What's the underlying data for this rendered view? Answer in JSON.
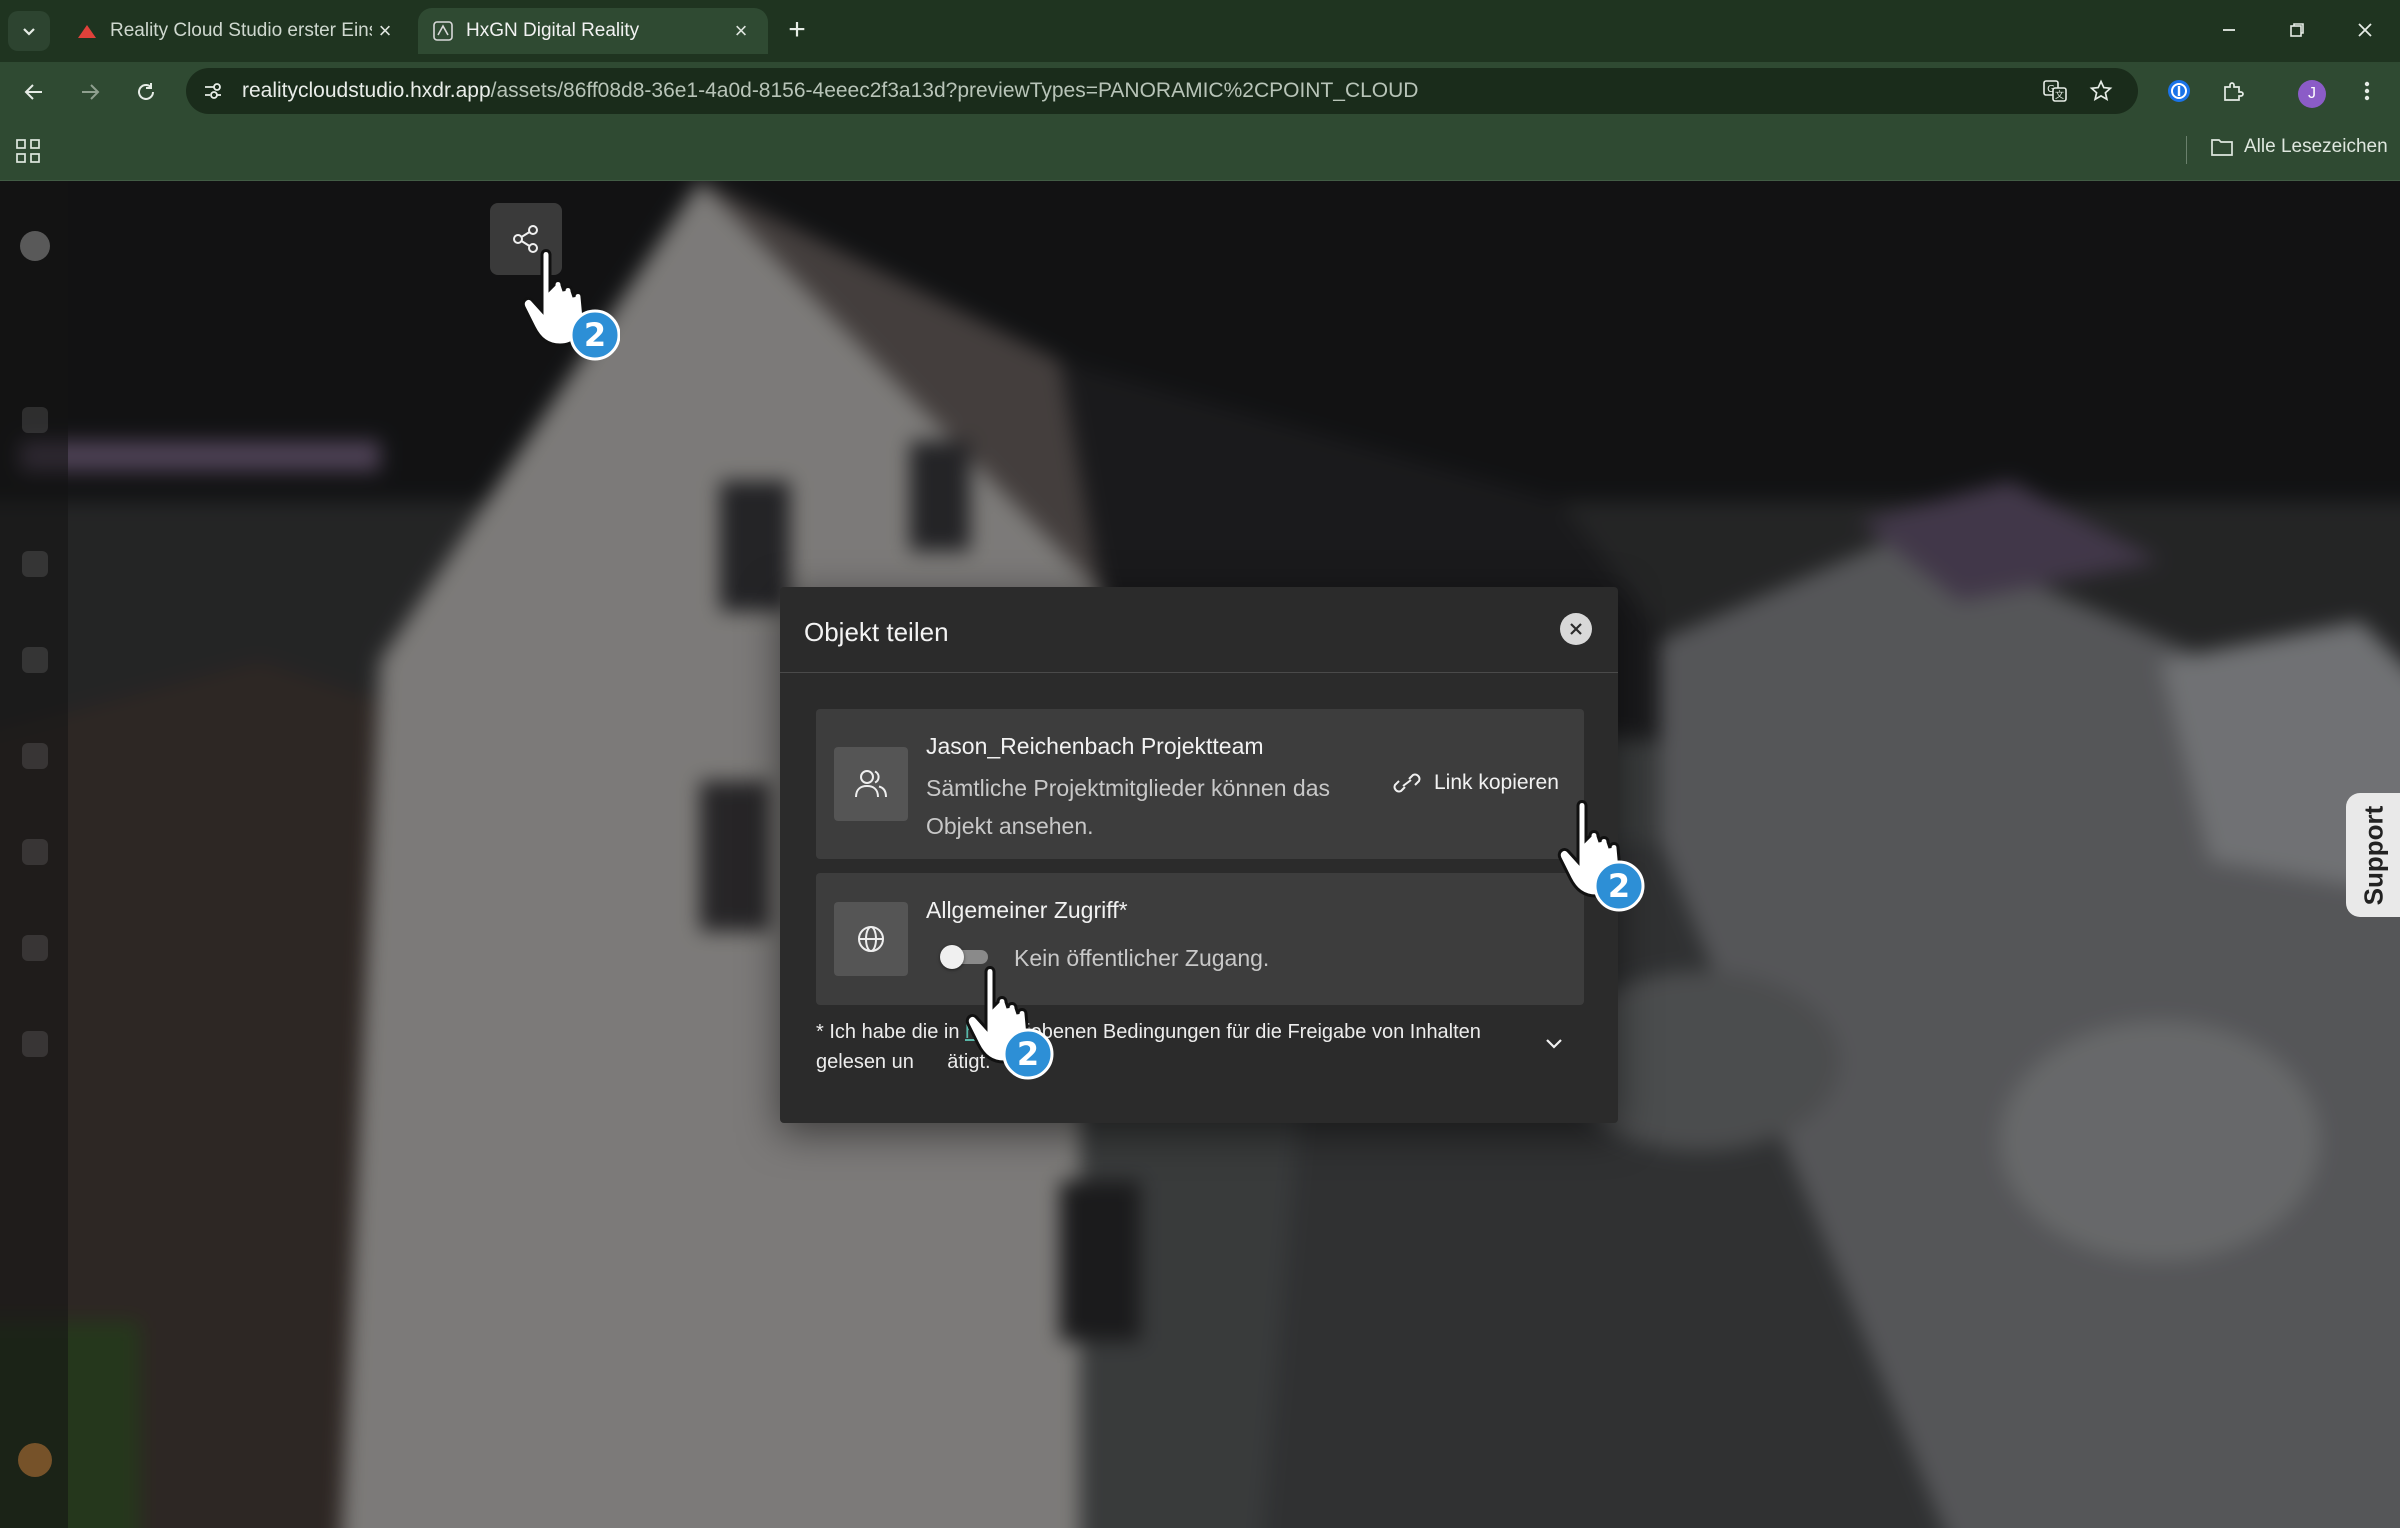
{
  "browser": {
    "tabs": [
      {
        "title": "Reality Cloud Studio erster Einst",
        "active": false,
        "icon": "red-triangle-icon"
      },
      {
        "title": "HxGN Digital Reality",
        "active": true,
        "icon": "hxgn-logo-icon"
      }
    ],
    "url_host": "realitycloudstudio.hxdr.app",
    "url_path": "/assets/86ff08d8-36e1-4a0d-8156-4eeec2f3a13d?previewTypes=PANORAMIC%2CPOINT_CLOUD",
    "profile_initial": "J",
    "bookmarks_label": "Alle Lesezeichen"
  },
  "modal": {
    "title": "Objekt teilen",
    "team_card": {
      "title": "Jason_Reichenbach Projektteam",
      "description": "Sämtliche Projektmitglieder können das Objekt ansehen.",
      "copy_link_label": "Link kopieren"
    },
    "access_card": {
      "title": "Allgemeiner Zugriff*",
      "toggle_label": "Kein öffentlicher Zugang.",
      "toggle_on": false
    },
    "terms": {
      "prefix": "* Ich habe die in ",
      "link": "h",
      "suffix": "    chriebenen Bedingungen für die Freigabe von Inhalten gelesen un      ätigt."
    }
  },
  "support_label": "Support",
  "colors": {
    "chrome_dark": "#1f3420",
    "chrome": "#2f4a32",
    "modal_bg": "#2b2b2b",
    "card_bg": "#3d3d3d",
    "accent_link": "#58b7a8",
    "step_badge": "#2d8fd6"
  },
  "tutorial_step_badge": "2"
}
